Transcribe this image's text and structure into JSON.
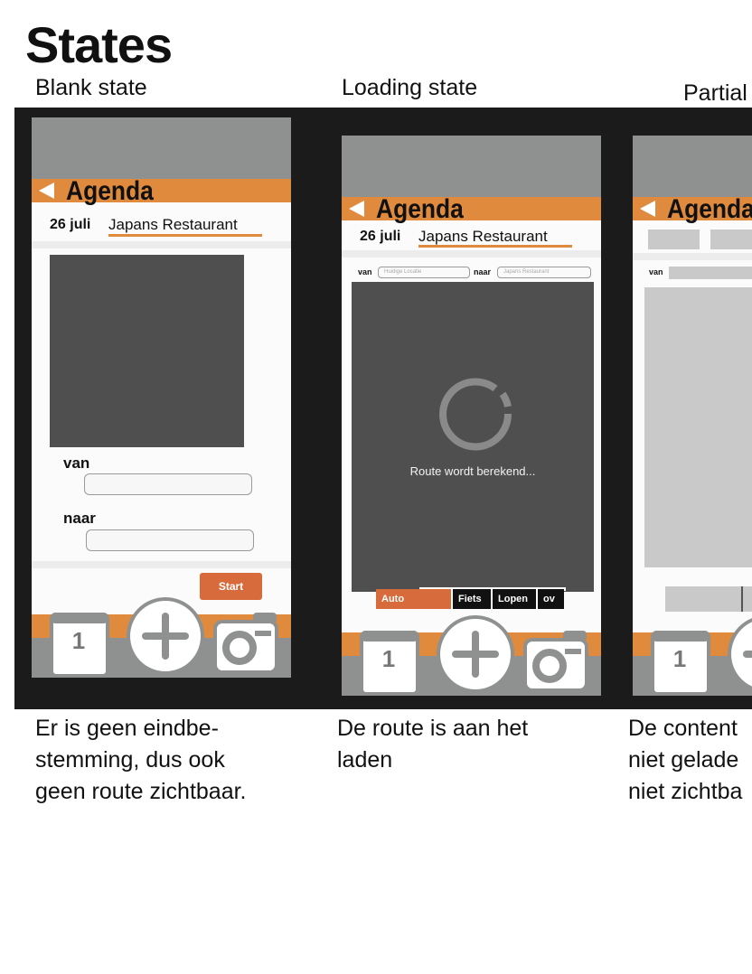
{
  "page": {
    "title": "States",
    "colors": {
      "accent": "#e08a3e",
      "start_button": "#d76b3b",
      "dark_band": "#1b1b1b",
      "map": "#4f4f4f",
      "status_bar": "#8e918f"
    }
  },
  "states": [
    {
      "label": "Blank state",
      "caption": "Er is geen eindbe-\nstemming, dus ook\ngeen route zichtbaar."
    },
    {
      "label": "Loading state",
      "caption": "De route is aan het\nladen"
    },
    {
      "label": "Partial",
      "caption": "De content\nniet gelade\nniet zichtba"
    }
  ],
  "app": {
    "header_title": "Agenda",
    "date": "26 juli",
    "destination": "Japans Restaurant",
    "from_label": "van",
    "to_label": "naar",
    "start_button": "Start",
    "from_placeholder": "Huidige Locatie",
    "to_placeholder": "Japans Restaurant",
    "loading_text": "Route wordt berekend...",
    "calendar_day": "1",
    "transport_modes": [
      "Auto",
      "Fiets",
      "Lopen",
      "ov"
    ],
    "icons": [
      "back-arrow-icon",
      "calendar-icon",
      "plus-icon",
      "camera-icon",
      "spinner-icon"
    ]
  }
}
